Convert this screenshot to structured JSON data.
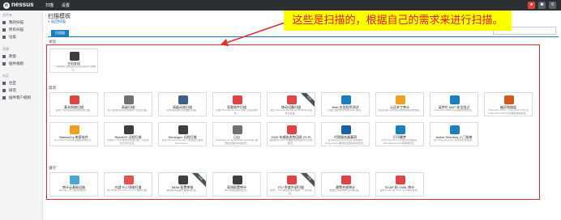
{
  "topbar": {
    "logo": "nessus",
    "nav": [
      "扫描",
      "设置"
    ]
  },
  "sidebar": {
    "sections": [
      {
        "label": "文件夹",
        "items": [
          "我的扫描",
          "所有扫描",
          "垃圾"
        ]
      },
      {
        "label": "资源",
        "items": [
          "政策",
          "插件规则"
        ]
      },
      {
        "label": "社区",
        "items": [
          "社区",
          "研究",
          "插件客户规则"
        ]
      }
    ]
  },
  "page": {
    "title": "扫描模板",
    "back_link": "< 返回扫描",
    "tab": "扫描器",
    "callout": "这些是扫描的，根据自己的需求来进行扫描。",
    "sections": [
      "发现",
      "漏洞",
      "遵守"
    ]
  },
  "discovery": [
    {
      "title": "主机发现",
      "desc": "一个简单的扫描来发现活动主机和开放端口。",
      "color": "#3a3f44"
    }
  ],
  "vulnerabilities": [
    {
      "title": "基本网络扫描",
      "desc": "适用于任何主机的完整系统扫描。",
      "color": "#e04545",
      "ribbon": ""
    },
    {
      "title": "高级扫描",
      "desc": "在不使用任何建议的情况下配置扫描。",
      "color": "#6b7177",
      "ribbon": ""
    },
    {
      "title": "高级动态扫描",
      "desc": "配置动态插件过滤器的扫描。",
      "color": "#3f5f8a",
      "ribbon": ""
    },
    {
      "title": "恶意软件扫描",
      "desc": "扫描 Windows 和 Unix 系统上的恶意软件。",
      "color": "#e04545",
      "ribbon": ""
    },
    {
      "title": "移动设备扫描",
      "desc": "通过 Microsoft Exchange 或 MDM 评估移动设备。",
      "color": "#e04545",
      "ribbon": "升级"
    },
    {
      "title": "Web 应用程序测试",
      "desc": "扫描已发布和未知的 Web 漏洞。",
      "color": "#1a7fbf",
      "ribbon": ""
    },
    {
      "title": "认证补丁审计",
      "desc": "对主机进行身份验证并枚举缺失的更新。",
      "color": "#f0a020",
      "ribbon": ""
    },
    {
      "title": "英特尔 AMT 安全绕过",
      "desc": "CVE-2017-5689 的远程和本地检查。",
      "color": "#1a7fbf",
      "ribbon": ""
    },
    {
      "title": "幽灵和熔毁",
      "desc": "CVE-2017-5753、CVE-2017-5715 和 CVE-2017-5754 的远程和本地检查。",
      "color": "#d05a1a",
      "ribbon": ""
    },
    {
      "title": "WannaCry 勒索软件",
      "desc": "针对 MS17-010 的远程和本地检查。",
      "color": "#f0a020",
      "ribbon": ""
    },
    {
      "title": "Ripple20 远程扫描",
      "desc": "网络中 Treck 堆栈的远程扫描，以检测运行中的主机。",
      "color": "#3a3f44",
      "ribbon": ""
    },
    {
      "title": "Zerologon 远程扫描",
      "desc": "检测 Microsoft Netlogon 特权提升漏洞 (Zerologon)。",
      "color": "#3a3f44",
      "ribbon": ""
    },
    {
      "title": "日出",
      "desc": "Solarigate 对 SolarWinds Solorigate 漏洞的远程和本地检查。",
      "color": "#6b7177",
      "ribbon": ""
    },
    {
      "title": "2020 年威胁态势回顾 (TLR)",
      "desc": "漏洞检测 2020 年威胁态势回顾中讨论的漏洞。",
      "color": "#e04545",
      "ribbon": ""
    },
    {
      "title": "代理服务器漏洞",
      "desc": "对 Microsoft Exchange 服务器中 ProxyLogon 漏洞的远程和本地检查。",
      "color": "#1a5fa8",
      "ribbon": ""
    },
    {
      "title": "打印噩梦",
      "desc": "针对 Windows 打印后台处理程序 (PrintNightmare) 的本地检查。",
      "color": "#1a7fbf",
      "ribbon": ""
    },
    {
      "title": "Active Directory 入门指南",
      "desc": "在 Active Directory 中查找配置错误。",
      "color": "#1a7fbf",
      "ribbon": ""
    }
  ],
  "compliance": [
    {
      "title": "审计云基础设施",
      "desc": "审计第三方云服务的配置。",
      "color": "#4aa8d8",
      "ribbon": ""
    },
    {
      "title": "内部 PCI 网络扫描",
      "desc": "执行内部 PCI DSS (11.2.1) 漏洞扫描。",
      "color": "#e85050",
      "ribbon": ""
    },
    {
      "title": "MDM 配置审核",
      "desc": "审核移动设备管理器的配置。",
      "color": "#3a3f44",
      "ribbon": "升级"
    },
    {
      "title": "离线配置审计",
      "desc": "审计网络设备的配置。",
      "color": "#3a3f44",
      "ribbon": ""
    },
    {
      "title": "PCI 季度外部扫描",
      "desc": "批准了 PCI 季度外部扫描的一个简化模板。",
      "color": "#e04545",
      "ribbon": "升级"
    },
    {
      "title": "政策合规审计",
      "desc": "根据已知基线审计系统配置。",
      "color": "#e04545",
      "ribbon": ""
    },
    {
      "title": "SCAP 和 OVAL 审计",
      "desc": "使用 SCAP 和 OVAL 定义审核系统。",
      "color": "#e04545",
      "ribbon": ""
    }
  ],
  "colors": {
    "topbar": "#2b3035",
    "accent": "#1a7fbf",
    "callout_bg": "#ffff00",
    "callout_text": "#e01b1b",
    "annotation": "#e03030"
  }
}
